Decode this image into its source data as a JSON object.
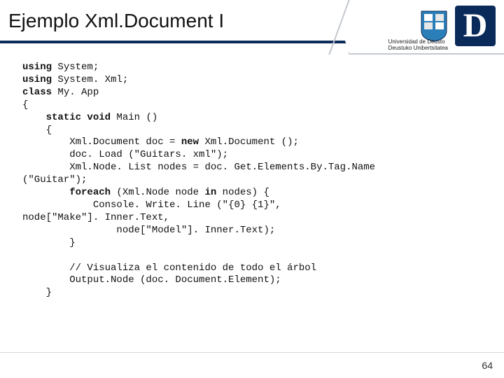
{
  "title": "Ejemplo Xml.Document I",
  "logo": {
    "letter": "D",
    "line1": "Universidad de Deusto",
    "line2": "Deustuko Unibertsitatea"
  },
  "code": {
    "l1a": "using",
    "l1b": " System;",
    "l2a": "using",
    "l2b": " System. Xml;",
    "l3a": "class",
    "l3b": " My. App",
    "l4": "{",
    "l5a": "    static void",
    "l5b": " Main ()",
    "l6": "    {",
    "l7a": "        Xml.Document doc = ",
    "l7b": "new",
    "l7c": " Xml.Document ();",
    "l8": "        doc. Load (\"Guitars. xml\");",
    "l9": "        Xml.Node. List nodes = doc. Get.Elements.By.Tag.Name",
    "l9b": "(\"Guitar\");",
    "l10a": "        foreach",
    "l10b": " (Xml.Node node ",
    "l10c": "in",
    "l10d": " nodes) {",
    "l11": "            Console. Write. Line (\"{0} {1}\",",
    "l11b": "node[\"Make\"]. Inner.Text,",
    "l12": "                node[\"Model\"]. Inner.Text);",
    "l13": "        }",
    "blank": "",
    "l14": "        // Visualiza el contenido de todo el árbol",
    "l15": "        Output.Node (doc. Document.Element);",
    "l16": "    }"
  },
  "page_number": "64"
}
